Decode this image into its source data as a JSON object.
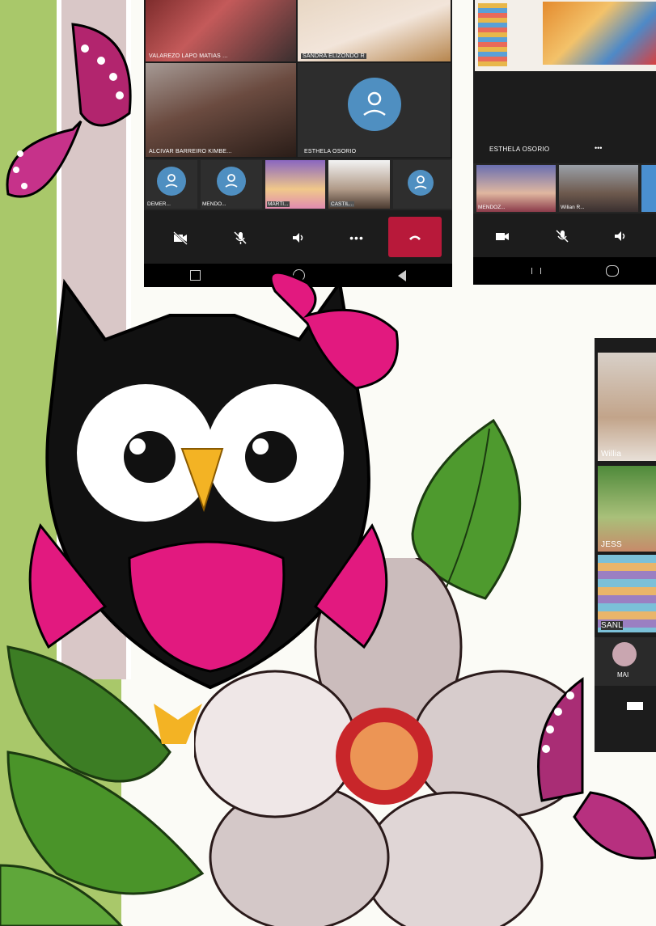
{
  "phone1": {
    "tiles": [
      {
        "label": "VALAREZO LAPO MATIAS ..."
      },
      {
        "label": "SANDRA ELIZONDO R"
      },
      {
        "label": "ALCIVAR BARREIRO KIMBE..."
      },
      {
        "label": "ESTHELA OSORIO"
      }
    ],
    "thumbs": [
      {
        "label": "DEMER..."
      },
      {
        "label": "MENDO..."
      },
      {
        "label": "MARTI..."
      },
      {
        "label": "CASTIL..."
      },
      {
        "label": ""
      }
    ],
    "controls": [
      "camera-off-icon",
      "mic-off-icon",
      "speaker-icon",
      "more-icon",
      "end-call-icon"
    ],
    "more_glyph": "•••"
  },
  "phone2": {
    "banner_label": "ESTHELA OSORIO",
    "more_glyph": "•••",
    "thumbs": [
      {
        "label": "MENDOZ..."
      },
      {
        "label": "Wilian R..."
      }
    ],
    "controls": [
      "camera-icon",
      "mic-off-icon",
      "speaker-icon"
    ]
  },
  "phone3": {
    "tiles": [
      {
        "label": "Willia"
      },
      {
        "label": "JESS"
      },
      {
        "label": "SANL"
      }
    ],
    "bottom_label": "MAI"
  },
  "colors": {
    "grass": "#a9c86a",
    "phone_bg": "#1c1c1c",
    "avatar_blue": "#4f8fc1",
    "end_call_red": "#b8193a",
    "owl_pink": "#e2197f"
  }
}
